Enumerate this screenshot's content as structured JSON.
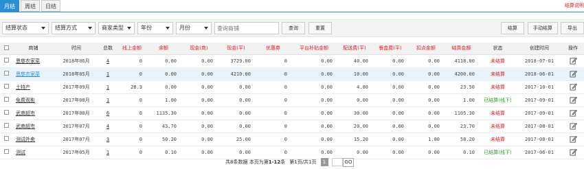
{
  "tabs": [
    "月结",
    "周结",
    "日结"
  ],
  "top_right_text": "结算说明",
  "filters": {
    "settle_status": "结算状态",
    "settle_method": "结算方式",
    "merchant_type": "商家类型",
    "year": "年份",
    "month": "月份",
    "search_placeholder": "查询商铺",
    "query_button": "查询",
    "reset_button": "重置"
  },
  "actions": {
    "settle": "结算",
    "manual_settle": "手动结算",
    "export": "导出"
  },
  "columns": [
    "",
    "商铺",
    "时间",
    "总数",
    "线上金额",
    "余额",
    "现金(商)",
    "现金(平)",
    "优惠券",
    "平台补贴金额",
    "配送费(平)",
    "餐盒费(平)",
    "扣点金额",
    "结算金额",
    "状态",
    "创建时间",
    "操作"
  ],
  "rows": [
    {
      "shop": "恩慈农家菜",
      "time": "2018年06月",
      "count": "4",
      "online": "0",
      "balance": "0.00",
      "cash_m": "0.00",
      "cash_p": "3729.00",
      "coupon": "0",
      "subsidy": "0.00",
      "delivery": "40.00",
      "box": "0.00",
      "deduct": "0.00",
      "settle": "4118.00",
      "status": "未结算",
      "status_color": "#e02020",
      "created": "2018-07-01"
    },
    {
      "shop": "恩慈农家菜",
      "time": "2018年05月",
      "count": "1",
      "online": "0",
      "balance": "0.00",
      "cash_m": "0.00",
      "cash_p": "4210.00",
      "coupon": "0",
      "subsidy": "0.00",
      "delivery": "10.00",
      "box": "0.00",
      "deduct": "0.00",
      "settle": "4200.00",
      "status": "未结算",
      "status_color": "#e02020",
      "created": "2018-06-01"
    },
    {
      "shop": "土特产",
      "time": "2017年09月",
      "count": "1",
      "online": "28.3",
      "balance": "0.00",
      "cash_m": "0.00",
      "cash_p": "0.00",
      "coupon": "0",
      "subsidy": "0.00",
      "delivery": "4.80",
      "box": "0.00",
      "deduct": "0.00",
      "settle": "23.50",
      "status": "未结算",
      "status_color": "#e02020",
      "created": "2017-10-01"
    },
    {
      "shop": "免费观影",
      "time": "2017年08月",
      "count": "1",
      "online": "0",
      "balance": "1.00",
      "cash_m": "0.00",
      "cash_p": "0.00",
      "coupon": "0",
      "subsidy": "0.00",
      "delivery": "0.00",
      "box": "0.00",
      "deduct": "0.00",
      "settle": "1.00",
      "status": "已结算(线下)",
      "status_color": "#2c9a2c",
      "created": "2017-09-01"
    },
    {
      "shop": "武商超市",
      "time": "2017年08月",
      "count": "6",
      "online": "0",
      "balance": "1135.30",
      "cash_m": "0.00",
      "cash_p": "0.00",
      "coupon": "0",
      "subsidy": "0.00",
      "delivery": "30.00",
      "box": "0.00",
      "deduct": "0.00",
      "settle": "1105.30",
      "status": "未结算",
      "status_color": "#e02020",
      "created": "2017-09-01"
    },
    {
      "shop": "武商超市",
      "time": "2017年07月",
      "count": "4",
      "online": "0",
      "balance": "43.70",
      "cash_m": "0.00",
      "cash_p": "0.00",
      "coupon": "0",
      "subsidy": "0.00",
      "delivery": "20.00",
      "box": "0.00",
      "deduct": "0.00",
      "settle": "23.70",
      "status": "未结算",
      "status_color": "#e02020",
      "created": "2017-08-01"
    },
    {
      "shop": "测试外卖",
      "time": "2017年07月",
      "count": "3",
      "online": "0",
      "balance": "50.20",
      "cash_m": "0.00",
      "cash_p": "25.00",
      "coupon": "0",
      "subsidy": "0.00",
      "delivery": "15.20",
      "box": "0.00",
      "deduct": "1.80",
      "settle": "58.20",
      "status": "未结算",
      "status_color": "#e02020",
      "created": "2017-08-01"
    },
    {
      "shop": "测试",
      "time": "2017年05月",
      "count": "1",
      "online": "0",
      "balance": "0.10",
      "cash_m": "0.00",
      "cash_p": "0.00",
      "coupon": "0",
      "subsidy": "0.00",
      "delivery": "0.00",
      "box": "0.00",
      "deduct": "0.00",
      "settle": "0.10",
      "status": "已结算(线下)",
      "status_color": "#2c9a2c",
      "created": "2017-06-01"
    }
  ],
  "highlight_row": 1,
  "pagination": {
    "total_prefix": "共",
    "total": "8",
    "total_suffix": "条数据 本页为第",
    "range": "1-12",
    "range_suffix": "条",
    "page_prefix": "第",
    "page": "1",
    "page_sep": "页/共",
    "pages": "1",
    "pages_suffix": "页",
    "current": "1",
    "go": "GO"
  },
  "accent_color": "#2a8fd5"
}
